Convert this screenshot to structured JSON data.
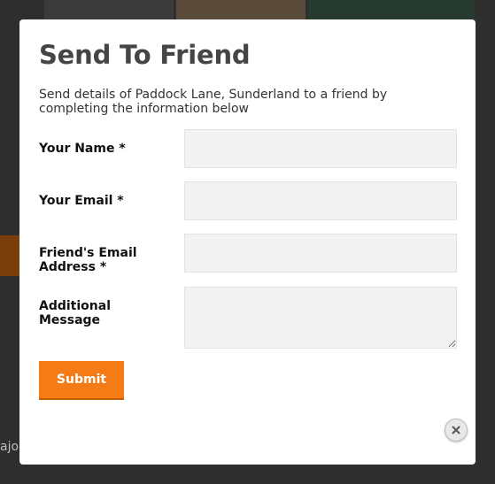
{
  "background": {
    "partial_text": "ajo"
  },
  "modal": {
    "title": "Send To Friend",
    "intro": "Send details of Paddock Lane, Sunderland to a friend by completing the information below",
    "fields": [
      {
        "label": "Your Name *",
        "value": ""
      },
      {
        "label": "Your Email *",
        "value": ""
      },
      {
        "label": "Friend's Email Address *",
        "value": ""
      },
      {
        "label": "Additional Message",
        "value": ""
      }
    ],
    "submit_label": "Submit",
    "close_icon": "close-icon"
  },
  "colors": {
    "accent": "#f47b16",
    "input_bg": "#f2f2f2",
    "title": "#454545"
  }
}
